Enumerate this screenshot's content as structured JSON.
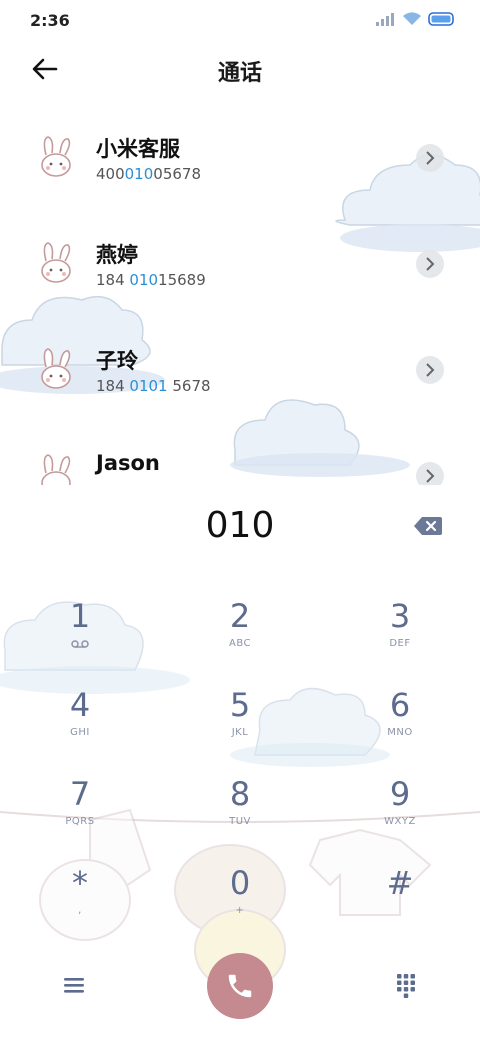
{
  "status_bar": {
    "time": "2:36"
  },
  "header": {
    "title": "通话"
  },
  "contacts": [
    {
      "name": "小米客服",
      "number_parts": [
        "400",
        "010",
        "05678"
      ]
    },
    {
      "name": "燕婷",
      "number_parts": [
        "184 ",
        "010",
        "15689"
      ]
    },
    {
      "name": "子玲",
      "number_parts": [
        "184 ",
        "0101",
        " 5678"
      ]
    },
    {
      "name": "Jason",
      "number_parts": [
        "",
        "",
        ""
      ]
    }
  ],
  "dial_input": "010",
  "keypad": [
    {
      "digit": "1",
      "letters": ""
    },
    {
      "digit": "2",
      "letters": "ABC"
    },
    {
      "digit": "3",
      "letters": "DEF"
    },
    {
      "digit": "4",
      "letters": "GHI"
    },
    {
      "digit": "5",
      "letters": "JKL"
    },
    {
      "digit": "6",
      "letters": "MNO"
    },
    {
      "digit": "7",
      "letters": "PQRS"
    },
    {
      "digit": "8",
      "letters": "TUV"
    },
    {
      "digit": "9",
      "letters": "WXYZ"
    },
    {
      "digit": "*",
      "letters": ","
    },
    {
      "digit": "0",
      "letters": "+"
    },
    {
      "digit": "#",
      "letters": ""
    }
  ],
  "colors": {
    "accent_highlight": "#2b8fd6",
    "call_button": "#c48a90",
    "keypad_digit": "#5d6b8c"
  },
  "icons": {
    "back": "arrow-left-icon",
    "more": "chevron-right-icon",
    "backspace": "backspace-icon",
    "voicemail": "voicemail-icon",
    "menu": "menu-icon",
    "call": "phone-icon",
    "keypad_toggle": "dialpad-icon"
  }
}
